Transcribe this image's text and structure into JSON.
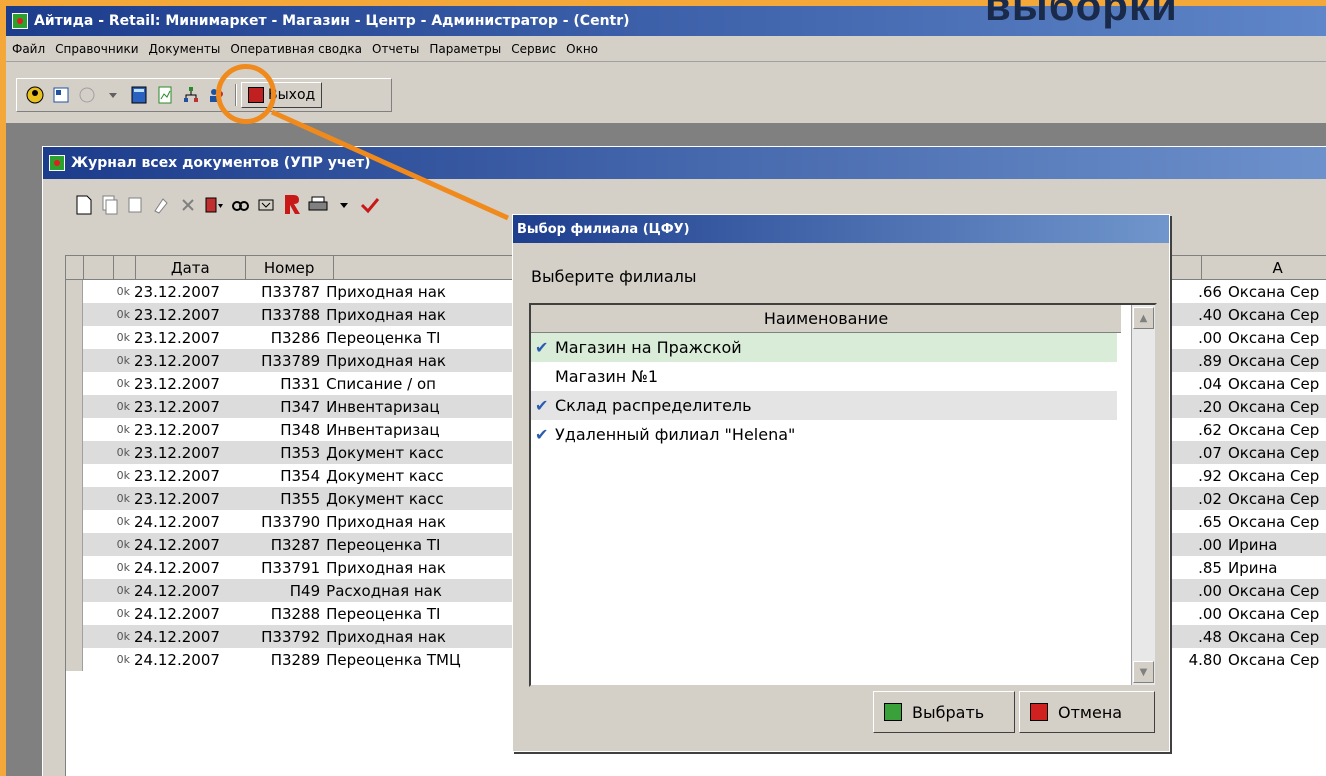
{
  "slide_title": "выборки",
  "app": {
    "title": "Айтида - Retail: Минимаркет - Магазин - Центр - Администратор - (Centr)",
    "menu": [
      "Файл",
      "Справочники",
      "Документы",
      "Оперативная сводка",
      "Отчеты",
      "Параметры",
      "Сервис",
      "Окно"
    ],
    "exit_label": "Выход"
  },
  "journal": {
    "title": "Журнал всех документов (УПР учет)",
    "columns": {
      "date": "Дата",
      "number": "Номер",
      "author": "А"
    },
    "rows": [
      {
        "status": "0k",
        "date": "23.12.2007",
        "number": "П33787",
        "doc": "Приходная нак",
        "sum": ".66",
        "author": "Оксана Сер"
      },
      {
        "status": "0k",
        "date": "23.12.2007",
        "number": "П33788",
        "doc": "Приходная нак",
        "sum": ".40",
        "author": "Оксана Сер"
      },
      {
        "status": "0k",
        "date": "23.12.2007",
        "number": "П3286",
        "doc": "Переоценка ТI",
        "sum": ".00",
        "author": "Оксана Сер"
      },
      {
        "status": "0k",
        "date": "23.12.2007",
        "number": "П33789",
        "doc": "Приходная нак",
        "sum": ".89",
        "author": "Оксана Сер"
      },
      {
        "status": "0k",
        "date": "23.12.2007",
        "number": "П331",
        "doc": "Списание / оп",
        "sum": ".04",
        "author": "Оксана Сер"
      },
      {
        "status": "0k",
        "date": "23.12.2007",
        "number": "П347",
        "doc": "Инвентаризац",
        "sum": ".20",
        "author": "Оксана Сер"
      },
      {
        "status": "0k",
        "date": "23.12.2007",
        "number": "П348",
        "doc": "Инвентаризац",
        "sum": ".62",
        "author": "Оксана Сер"
      },
      {
        "status": "0k",
        "date": "23.12.2007",
        "number": "П353",
        "doc": "Документ касс",
        "sum": ".07",
        "author": "Оксана Сер"
      },
      {
        "status": "0k",
        "date": "23.12.2007",
        "number": "П354",
        "doc": "Документ касс",
        "sum": ".92",
        "author": "Оксана Сер"
      },
      {
        "status": "0k",
        "date": "23.12.2007",
        "number": "П355",
        "doc": "Документ касс",
        "sum": ".02",
        "author": "Оксана Сер"
      },
      {
        "status": "0k",
        "date": "24.12.2007",
        "number": "П33790",
        "doc": "Приходная нак",
        "sum": ".65",
        "author": "Оксана Сер"
      },
      {
        "status": "0k",
        "date": "24.12.2007",
        "number": "П3287",
        "doc": "Переоценка ТI",
        "sum": ".00",
        "author": "Ирина"
      },
      {
        "status": "0k",
        "date": "24.12.2007",
        "number": "П33791",
        "doc": "Приходная нак",
        "sum": ".85",
        "author": "Ирина"
      },
      {
        "status": "0k",
        "date": "24.12.2007",
        "number": "П49",
        "doc": "Расходная нак",
        "sum": ".00",
        "author": "Оксана Сер"
      },
      {
        "status": "0k",
        "date": "24.12.2007",
        "number": "П3288",
        "doc": "Переоценка ТI",
        "sum": ".00",
        "author": "Оксана Сер"
      },
      {
        "status": "0k",
        "date": "24.12.2007",
        "number": "П33792",
        "doc": "Приходная нак",
        "sum": ".48",
        "author": "Оксана Сер"
      },
      {
        "status": "0k",
        "date": "24.12.2007",
        "number": "П3289",
        "doc": "Переоценка ТМЦ",
        "sum": "4.80",
        "author": "Оксана Сер"
      }
    ]
  },
  "dialog": {
    "title": "Выбор филиала (ЦФУ)",
    "prompt": "Выберите филиалы",
    "column_header": "Наименование",
    "items": [
      {
        "label": "Магазин на Пражской",
        "checked": true
      },
      {
        "label": "Магазин №1",
        "checked": false
      },
      {
        "label": "Склад распределитель",
        "checked": true
      },
      {
        "label": "Удаленный филиал \"Helena\"",
        "checked": true
      }
    ],
    "ok_label": "Выбрать",
    "cancel_label": "Отмена"
  }
}
